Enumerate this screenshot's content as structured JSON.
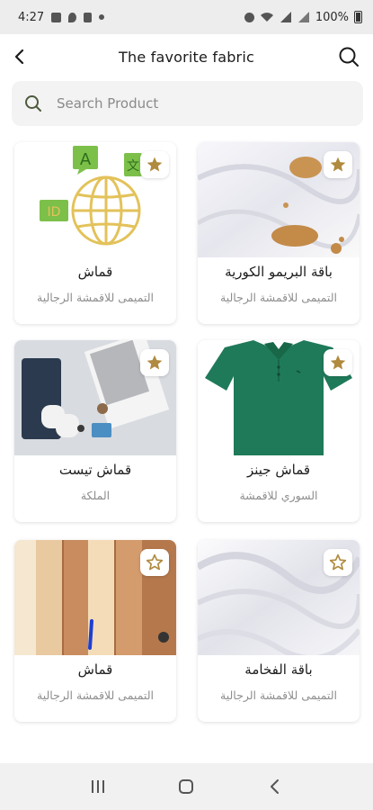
{
  "status_bar": {
    "time": "4:27",
    "battery": "100%"
  },
  "header": {
    "title": "The favorite fabric",
    "back_icon": "chevron-left-icon",
    "search_icon": "search-icon"
  },
  "search": {
    "placeholder": "Search Product",
    "value": ""
  },
  "colors": {
    "accent_gold": "#b08a3e",
    "card_bg": "#ffffff",
    "search_bg": "#f3f3f3"
  },
  "products": [
    {
      "title": "قماش",
      "subtitle": "التميمى للاقمشة الرجالية",
      "favorited": true,
      "image": "globe-language-icon"
    },
    {
      "title": "باقة البريمو الكورية",
      "subtitle": "التميمى للاقمشة الرجالية",
      "favorited": true,
      "image": "stained-white-fabric"
    },
    {
      "title": "قماش تيست",
      "subtitle": "الملكة",
      "favorited": true,
      "image": "clothing-flatlay"
    },
    {
      "title": "قماش جينز",
      "subtitle": "السوري للاقمشة",
      "favorited": true,
      "image": "green-polo-shirt"
    },
    {
      "title": "قماش",
      "subtitle": "التميمى للاقمشة الرجالية",
      "favorited": false,
      "image": "fabric-swatches"
    },
    {
      "title": "باقة الفخامة",
      "subtitle": "التميمى للاقمشة الرجالية",
      "favorited": false,
      "image": "white-draped-fabric"
    }
  ],
  "nav": {
    "recent_icon": "recent-apps-icon",
    "home_icon": "home-icon",
    "back_icon": "back-icon"
  }
}
